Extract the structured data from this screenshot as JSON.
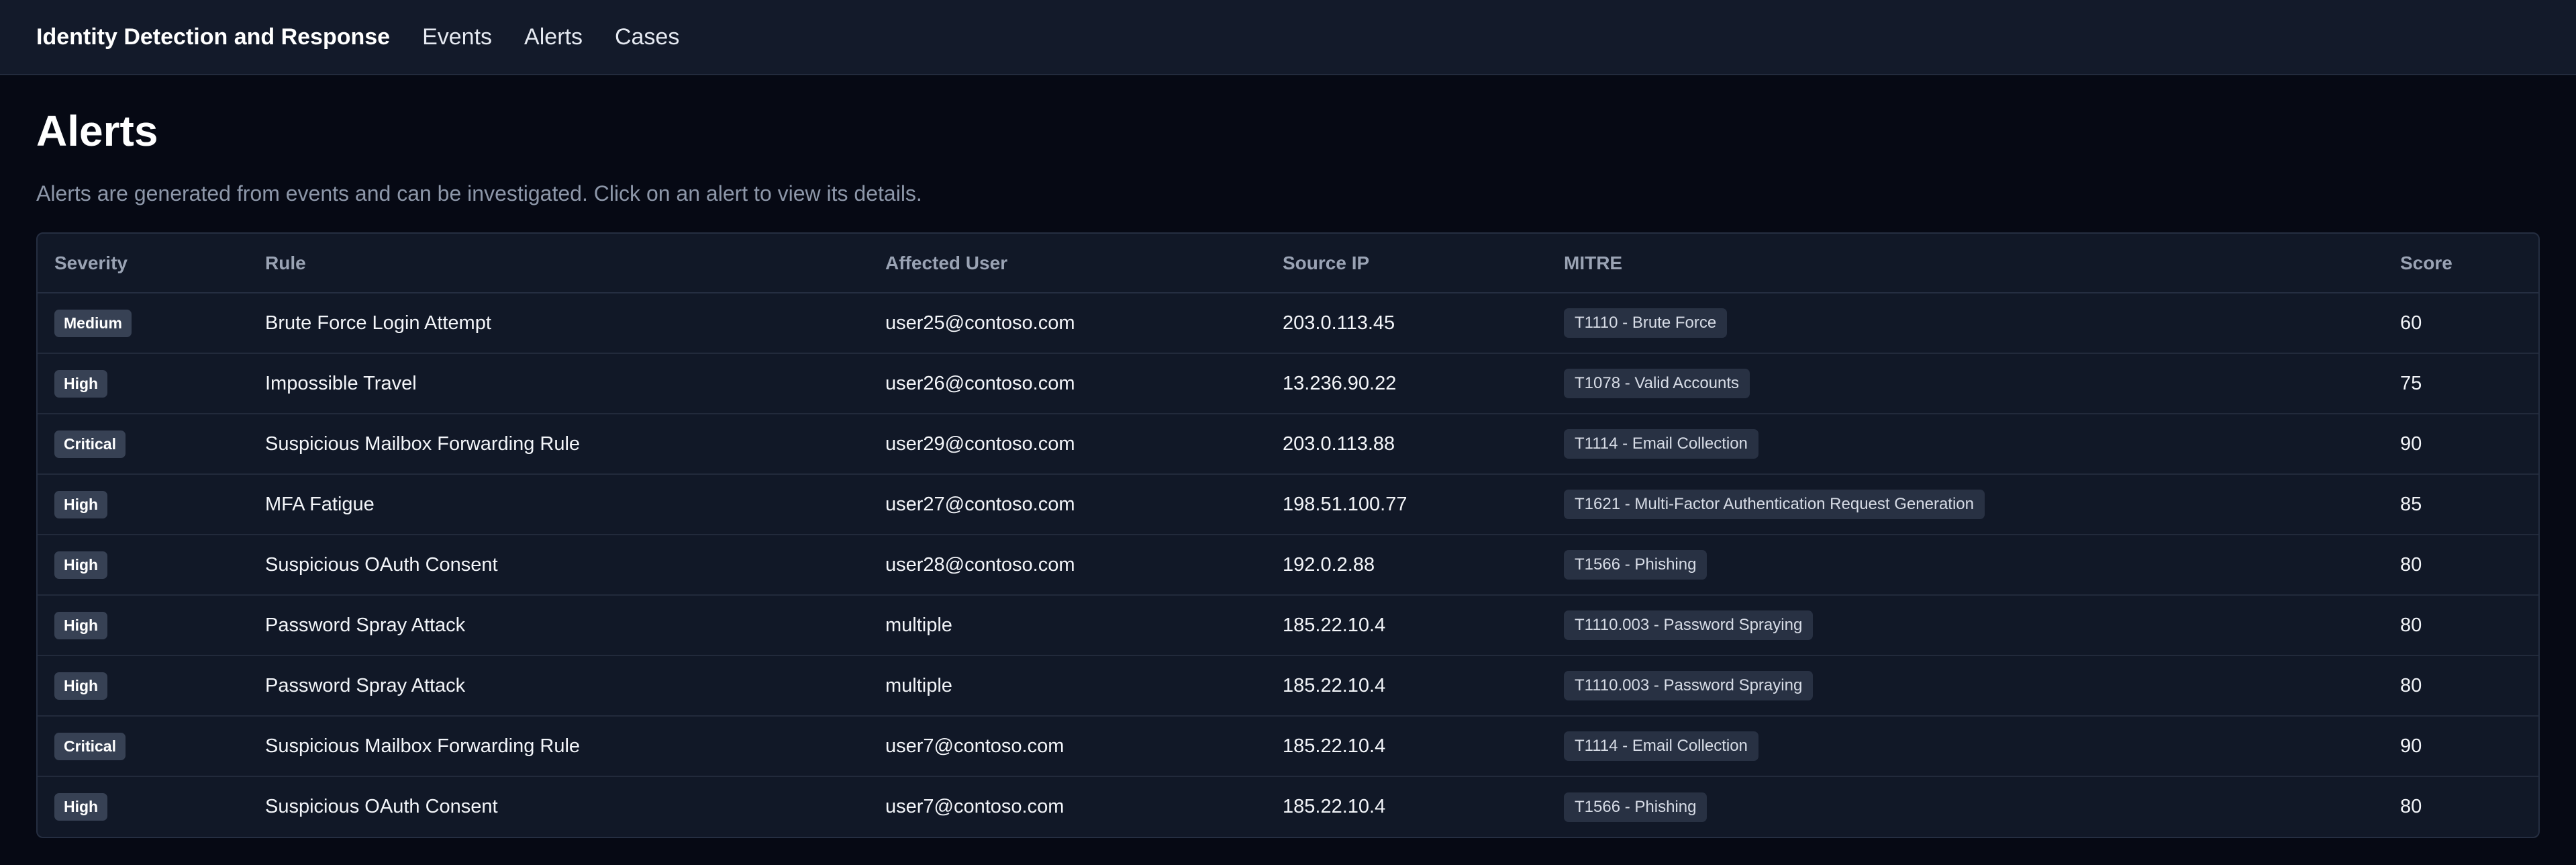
{
  "nav": {
    "brand": "Identity Detection and Response",
    "links": [
      "Events",
      "Alerts",
      "Cases"
    ]
  },
  "page": {
    "title": "Alerts",
    "description": "Alerts are generated from events and can be investigated. Click on an alert to view its details."
  },
  "table": {
    "columns": [
      "Severity",
      "Rule",
      "Affected User",
      "Source IP",
      "MITRE",
      "Score"
    ],
    "rows": [
      {
        "severity": "Medium",
        "rule": "Brute Force Login Attempt",
        "user": "user25@contoso.com",
        "ip": "203.0.113.45",
        "mitre": "T1110 - Brute Force",
        "score": "60"
      },
      {
        "severity": "High",
        "rule": "Impossible Travel",
        "user": "user26@contoso.com",
        "ip": "13.236.90.22",
        "mitre": "T1078 - Valid Accounts",
        "score": "75"
      },
      {
        "severity": "Critical",
        "rule": "Suspicious Mailbox Forwarding Rule",
        "user": "user29@contoso.com",
        "ip": "203.0.113.88",
        "mitre": "T1114 - Email Collection",
        "score": "90"
      },
      {
        "severity": "High",
        "rule": "MFA Fatigue",
        "user": "user27@contoso.com",
        "ip": "198.51.100.77",
        "mitre": "T1621 - Multi-Factor Authentication Request Generation",
        "score": "85"
      },
      {
        "severity": "High",
        "rule": "Suspicious OAuth Consent",
        "user": "user28@contoso.com",
        "ip": "192.0.2.88",
        "mitre": "T1566 - Phishing",
        "score": "80"
      },
      {
        "severity": "High",
        "rule": "Password Spray Attack",
        "user": "multiple",
        "ip": "185.22.10.4",
        "mitre": "T1110.003 - Password Spraying",
        "score": "80"
      },
      {
        "severity": "High",
        "rule": "Password Spray Attack",
        "user": "multiple",
        "ip": "185.22.10.4",
        "mitre": "T1110.003 - Password Spraying",
        "score": "80"
      },
      {
        "severity": "Critical",
        "rule": "Suspicious Mailbox Forwarding Rule",
        "user": "user7@contoso.com",
        "ip": "185.22.10.4",
        "mitre": "T1114 - Email Collection",
        "score": "90"
      },
      {
        "severity": "High",
        "rule": "Suspicious OAuth Consent",
        "user": "user7@contoso.com",
        "ip": "185.22.10.4",
        "mitre": "T1566 - Phishing",
        "score": "80"
      }
    ]
  },
  "colors": {
    "background": "#060914",
    "nav_background": "#131a2a",
    "card_background": "#111827",
    "badge_background": "#374154",
    "mitre_tag_background": "#283143"
  }
}
